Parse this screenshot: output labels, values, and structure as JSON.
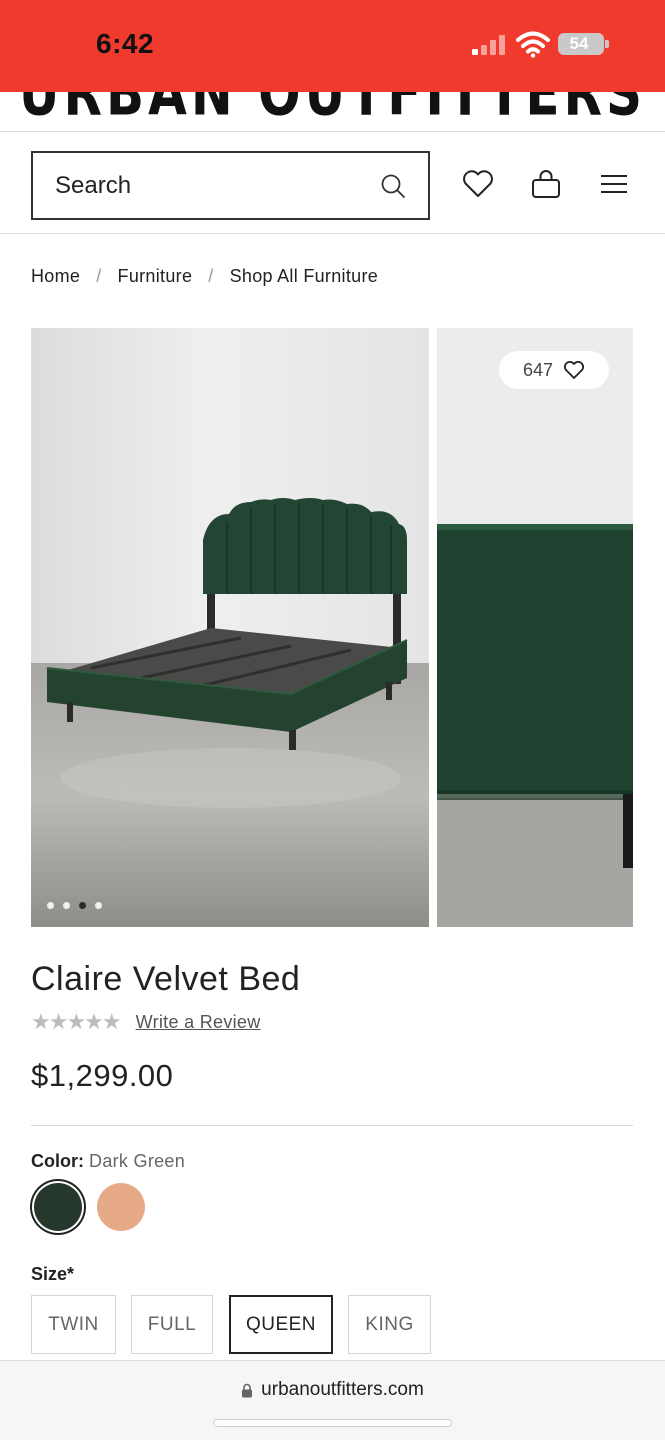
{
  "status_bar": {
    "time": "6:42",
    "battery": "54"
  },
  "header": {
    "logo": "URBAN OUTFITTERS",
    "search_placeholder": "Search"
  },
  "breadcrumb": [
    "Home",
    "Furniture",
    "Shop All Furniture"
  ],
  "gallery": {
    "likes": "647",
    "dot_count": 4,
    "active_dot": 2
  },
  "product": {
    "title": "Claire Velvet Bed",
    "rating_stars": "★★★★★",
    "write_review": "Write a Review",
    "price": "$1,299.00"
  },
  "color": {
    "label": "Color:",
    "selected": "Dark Green",
    "swatches": [
      {
        "name": "Dark Green",
        "hex": "#26382c"
      },
      {
        "name": "Peach",
        "hex": "#e6ab86"
      }
    ]
  },
  "size": {
    "label": "Size*",
    "options": [
      "TWIN",
      "FULL",
      "QUEEN",
      "KING"
    ],
    "selected": "QUEEN"
  },
  "browser": {
    "url": "urbanoutfitters.com"
  },
  "colors": {
    "status_bar": "#ef3a2d",
    "velvet_green": "#234634"
  }
}
